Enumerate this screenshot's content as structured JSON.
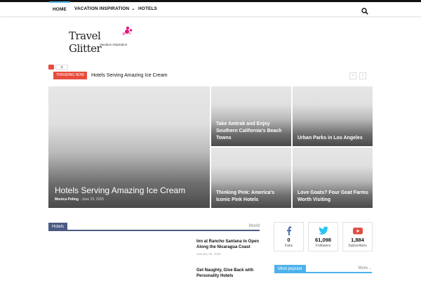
{
  "colors": {
    "accent": "#4db2ec",
    "trending": "#e74c3c",
    "block": "#4a5b83",
    "facebook": "#516eab",
    "twitter": "#29c5f6",
    "youtube": "#e14e42"
  },
  "nav": {
    "home": "HOME",
    "vacation": "VACATION INSPIRATION",
    "hotels": "HOTELS",
    "search_icon": "search-icon"
  },
  "logo": {
    "name": "Travel Glitter",
    "tagline": "Vacation Inspiration"
  },
  "social_mini": {
    "count": "3"
  },
  "trending": {
    "label": "TRENDING NOW",
    "title": "Hotels Serving Amazing Ice Cream",
    "prev": "‹",
    "next": "›"
  },
  "featured": {
    "big": {
      "title": "Hotels Serving Amazing Ice Cream",
      "author": "Monica Poling",
      "date": "June 23, 2015"
    },
    "small": [
      {
        "title": "Take Amtrak and Enjoy Southern California's Beach Towns"
      },
      {
        "title": "Urban Parks in Los Angeles"
      },
      {
        "title": "Thinking Pink: America's Iconic Pink Hotels"
      },
      {
        "title": "Love Goats? Four Goat Farms Worth Visiting"
      }
    ]
  },
  "block": {
    "tab": "Hotels",
    "filter": "World",
    "posts": [
      {
        "title": "Inn at Rancho Santana to Open Along the Nicaragua Coast",
        "date": "January 26, 2015"
      },
      {
        "title": "Get Naughty, Give Back with Personality Hotels",
        "date": ""
      }
    ]
  },
  "social": [
    {
      "icon": "facebook-icon",
      "count": "0",
      "label": "Fans"
    },
    {
      "icon": "twitter-icon",
      "count": "61,098",
      "label": "Followers"
    },
    {
      "icon": "youtube-icon",
      "count": "1,884",
      "label": "Subscribers"
    }
  ],
  "popular": {
    "tab": "Most popular",
    "more": "More"
  }
}
